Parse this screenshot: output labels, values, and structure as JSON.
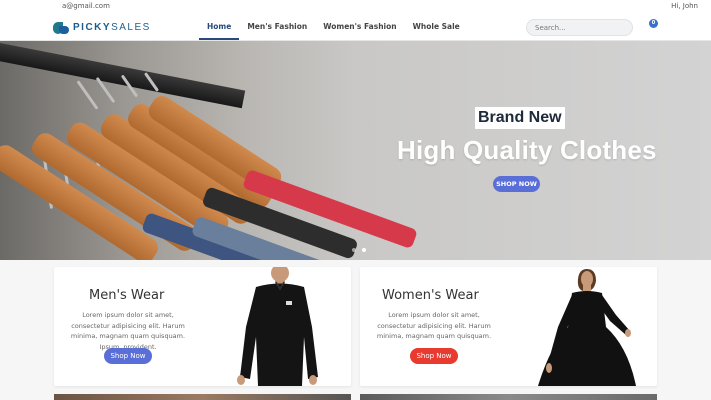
{
  "topbar": {
    "email": "a@gmail.com",
    "greeting": "Hi, John"
  },
  "logo": {
    "brand_first": "PICKY",
    "brand_second": "SALES"
  },
  "menu": [
    {
      "label": "Home"
    },
    {
      "label": "Men's Fashion"
    },
    {
      "label": "Women's Fashion"
    },
    {
      "label": "Whole Sale"
    }
  ],
  "search": {
    "placeholder": "Search..."
  },
  "cart": {
    "count": "0"
  },
  "hero": {
    "badge": "Brand New",
    "headline": "High Quality Clothes",
    "button": "SHOP NOW",
    "slides": 2,
    "active_slide": 2
  },
  "cards": [
    {
      "title": "Men's Wear",
      "text": "Lorem ipsum dolor sit amet, consectetur adipisicing elit. Harum minima, magnam quam quisquam. Ipsum, provident.",
      "button": "Shop Now",
      "button_color": "#5a6ed8"
    },
    {
      "title": "Women's Wear",
      "text": "Lorem ipsum dolor sit amet, consectetur adipisicing elit. Harum minima, magnam quam quisquam.",
      "button": "Shop Now",
      "button_color": "#e83a2e"
    }
  ],
  "colors": {
    "accent": "#5a6ed8",
    "nav_active": "#2a4a7a",
    "women_button": "#e83a2e"
  }
}
